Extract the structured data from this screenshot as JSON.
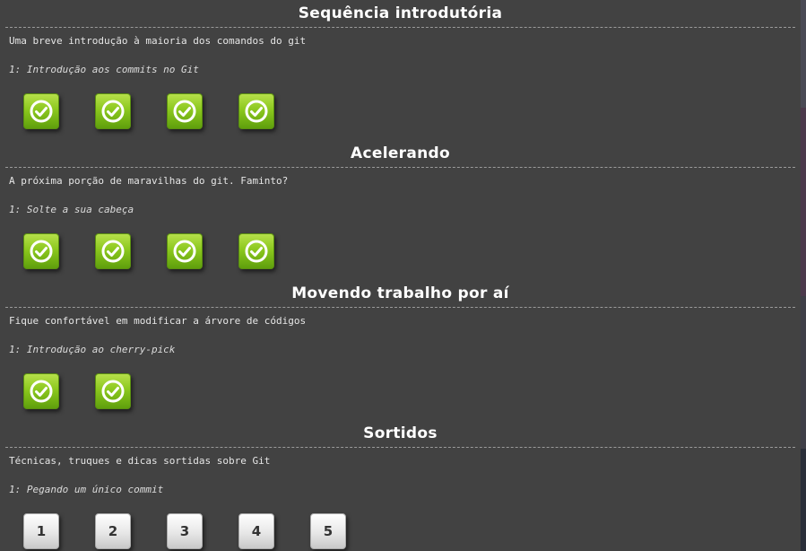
{
  "sections": [
    {
      "title": "Sequência introdutória",
      "about": "Uma breve introdução à maioria dos comandos do git",
      "next_level": "1: Introdução aos commits no Git",
      "levels": [
        {
          "status": "solved"
        },
        {
          "status": "solved"
        },
        {
          "status": "solved"
        },
        {
          "status": "solved"
        }
      ]
    },
    {
      "title": "Acelerando",
      "about": "A próxima porção de maravilhas do git. Faminto?",
      "next_level": "1: Solte a sua cabeça",
      "levels": [
        {
          "status": "solved"
        },
        {
          "status": "solved"
        },
        {
          "status": "solved"
        },
        {
          "status": "solved"
        }
      ]
    },
    {
      "title": "Movendo trabalho por aí",
      "about": "Fique confortável em modificar a árvore de códigos",
      "next_level": "1: Introdução ao cherry-pick",
      "levels": [
        {
          "status": "solved"
        },
        {
          "status": "solved"
        }
      ]
    },
    {
      "title": "Sortidos",
      "about": "Técnicas, truques e dicas sortidas sobre Git",
      "next_level": "1: Pegando um único commit",
      "levels": [
        {
          "status": "open",
          "label": "1"
        },
        {
          "status": "open",
          "label": "2"
        },
        {
          "status": "open",
          "label": "3"
        },
        {
          "status": "open",
          "label": "4"
        },
        {
          "status": "open",
          "label": "5"
        }
      ]
    }
  ],
  "colors": {
    "background": "#424242",
    "solved_green": "#8cc81e",
    "open_gray": "#e7e7e7",
    "divider": "#9a9a9a"
  },
  "icons": {
    "solved": "check-circle-icon"
  }
}
